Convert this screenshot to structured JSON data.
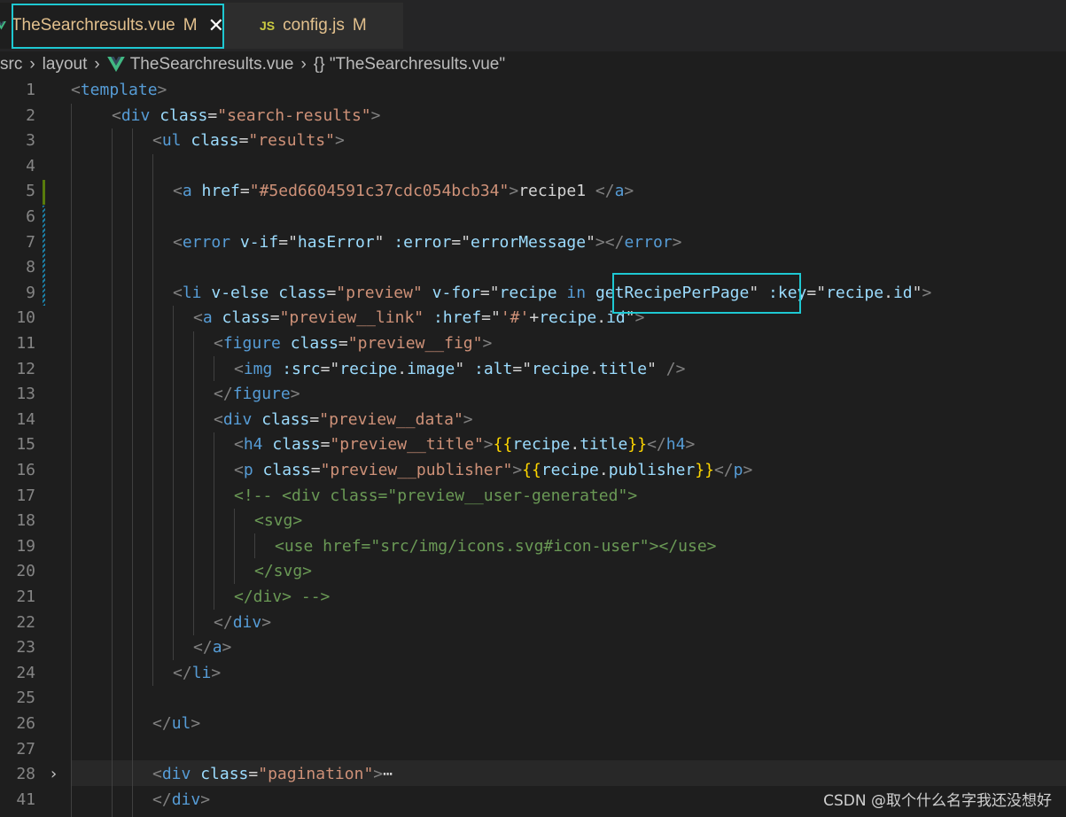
{
  "tabs": [
    {
      "filename": "TheSearchresults.vue",
      "modified": "M",
      "icon": "vue-icon",
      "active": true
    },
    {
      "filename": "config.js",
      "modified": "M",
      "icon_label": "JS",
      "active": false
    }
  ],
  "close_glyph": "✕",
  "breadcrumb": [
    "src",
    "layout",
    "TheSearchresults.vue",
    "{} \"TheSearchresults.vue\""
  ],
  "editor": {
    "line_numbers": [
      "1",
      "2",
      "3",
      "4",
      "5",
      "6",
      "7",
      "8",
      "9",
      "10",
      "11",
      "12",
      "13",
      "14",
      "15",
      "16",
      "17",
      "18",
      "19",
      "20",
      "21",
      "22",
      "23",
      "24",
      "25",
      "26",
      "27",
      "28",
      "41"
    ],
    "fold_marker": "›",
    "folded_ellipsis": "⋯"
  },
  "highlighted_token": "getRecipePerPage",
  "watermark": "CSDN @取个什么名字我还没想好",
  "colors": {
    "highlight_border": "#1ec8d2",
    "modified": "#e2c08d",
    "background": "#1e1e1e"
  }
}
